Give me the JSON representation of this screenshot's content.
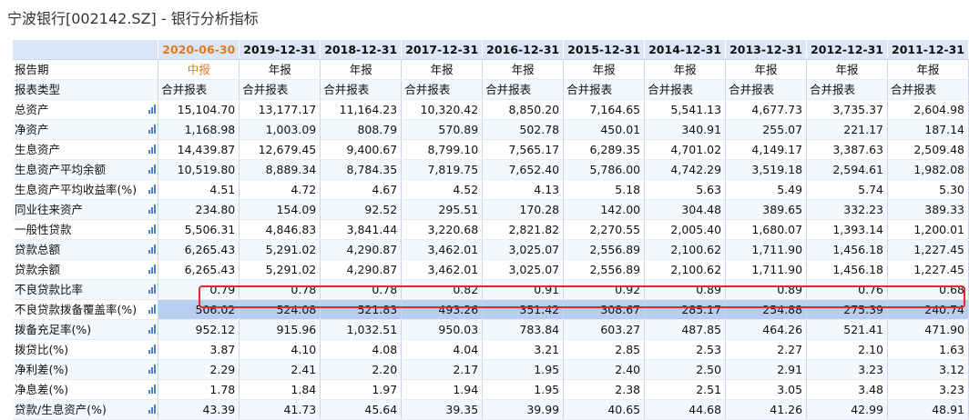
{
  "title": "宁波银行[002142.SZ] - 银行分析指标",
  "accent_color": "#e07b1f",
  "highlight_color": "#e22a2a",
  "row_icon": "bar-chart-icon",
  "columns": [
    "2020-06-30",
    "2019-12-31",
    "2018-12-31",
    "2017-12-31",
    "2016-12-31",
    "2015-12-31",
    "2014-12-31",
    "2013-12-31",
    "2012-12-31",
    "2011-12-31"
  ],
  "selected_column": 0,
  "report_period": {
    "label": "报告期",
    "values": [
      "中报",
      "年报",
      "年报",
      "年报",
      "年报",
      "年报",
      "年报",
      "年报",
      "年报",
      "年报"
    ]
  },
  "report_type": {
    "label": "报表类型",
    "values": [
      "合并报表",
      "合并报表",
      "合并报表",
      "合并报表",
      "合并报表",
      "合并报表",
      "合并报表",
      "合并报表",
      "合并报表",
      "合并报表"
    ]
  },
  "rows": [
    {
      "label": "总资产",
      "values": [
        "15,104.70",
        "13,177.17",
        "11,164.23",
        "10,320.42",
        "8,850.20",
        "7,164.65",
        "5,541.13",
        "4,677.73",
        "3,735.37",
        "2,604.98"
      ]
    },
    {
      "label": "净资产",
      "values": [
        "1,168.98",
        "1,003.09",
        "808.79",
        "570.89",
        "502.78",
        "450.01",
        "340.91",
        "255.07",
        "221.17",
        "187.14"
      ]
    },
    {
      "label": "生息资产",
      "values": [
        "14,439.87",
        "12,679.45",
        "9,400.67",
        "8,799.10",
        "7,565.17",
        "6,289.35",
        "4,701.02",
        "4,149.17",
        "3,387.63",
        "2,509.48"
      ]
    },
    {
      "label": "生息资产平均余额",
      "values": [
        "10,519.80",
        "8,889.34",
        "8,784.35",
        "7,819.75",
        "7,652.40",
        "5,786.00",
        "4,742.29",
        "3,519.18",
        "2,594.61",
        "1,982.08"
      ]
    },
    {
      "label": "生息资产平均收益率(%)",
      "values": [
        "4.51",
        "4.72",
        "4.67",
        "4.52",
        "4.13",
        "5.18",
        "5.63",
        "5.49",
        "5.74",
        "5.30"
      ]
    },
    {
      "label": "同业往来资产",
      "values": [
        "234.80",
        "154.09",
        "92.52",
        "295.51",
        "170.28",
        "142.00",
        "304.48",
        "389.65",
        "332.23",
        "389.33"
      ]
    },
    {
      "label": "一般性贷款",
      "values": [
        "5,506.31",
        "4,846.83",
        "3,841.44",
        "3,220.68",
        "2,821.82",
        "2,270.55",
        "2,005.40",
        "1,680.07",
        "1,393.14",
        "1,200.01"
      ]
    },
    {
      "label": "贷款总额",
      "values": [
        "6,265.43",
        "5,291.02",
        "4,290.87",
        "3,462.01",
        "3,025.07",
        "2,556.89",
        "2,100.62",
        "1,711.90",
        "1,456.18",
        "1,227.45"
      ]
    },
    {
      "label": "贷款余额",
      "values": [
        "6,265.43",
        "5,291.02",
        "4,290.87",
        "3,462.01",
        "3,025.07",
        "2,556.89",
        "2,100.62",
        "1,711.90",
        "1,456.18",
        "1,227.45"
      ]
    },
    {
      "label": "不良贷款比率",
      "values": [
        "0.79",
        "0.78",
        "0.78",
        "0.82",
        "0.91",
        "0.92",
        "0.89",
        "0.89",
        "0.76",
        "0.68"
      ]
    },
    {
      "label": "不良贷款拨备覆盖率(%)",
      "values": [
        "506.02",
        "524.08",
        "521.83",
        "493.26",
        "351.42",
        "308.67",
        "285.17",
        "254.88",
        "275.39",
        "240.74"
      ],
      "highlighted": true
    },
    {
      "label": "拨备充足率(%)",
      "values": [
        "952.12",
        "915.96",
        "1,032.51",
        "950.03",
        "783.84",
        "603.27",
        "487.85",
        "464.26",
        "521.41",
        "471.90"
      ]
    },
    {
      "label": "拨贷比(%)",
      "values": [
        "3.87",
        "4.10",
        "4.08",
        "4.04",
        "3.21",
        "2.85",
        "2.53",
        "2.27",
        "2.10",
        "1.63"
      ]
    },
    {
      "label": "净利差(%)",
      "values": [
        "2.29",
        "2.41",
        "2.20",
        "2.17",
        "1.95",
        "2.40",
        "2.50",
        "2.91",
        "3.23",
        "3.12"
      ]
    },
    {
      "label": "净息差(%)",
      "values": [
        "1.78",
        "1.84",
        "1.97",
        "1.94",
        "1.95",
        "2.38",
        "2.51",
        "3.05",
        "3.48",
        "3.23"
      ]
    },
    {
      "label": "贷款/生息资产(%)",
      "values": [
        "43.39",
        "41.73",
        "45.64",
        "39.35",
        "39.99",
        "40.65",
        "44.68",
        "41.26",
        "42.99",
        "48.91"
      ]
    }
  ]
}
